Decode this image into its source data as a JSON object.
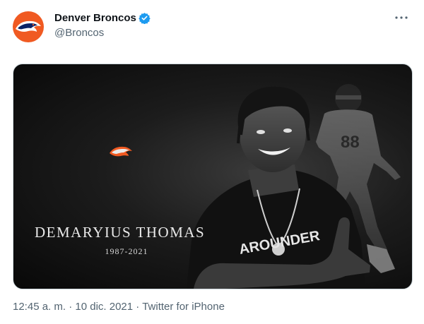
{
  "account": {
    "display_name": "Denver Broncos",
    "handle": "@Broncos",
    "avatar_icon": "broncos-logo-icon",
    "verified_icon": "verified-badge-icon",
    "brand_color": "#f05a22"
  },
  "menu": {
    "more_icon": "more-options-icon"
  },
  "media": {
    "name": "DEMARYIUS THOMAS",
    "years": "1987-2021",
    "jersey_number": "88",
    "shirt_text": "AROUNDER"
  },
  "meta": {
    "time": "12:45 a. m.",
    "separator": " · ",
    "date": "10 dic. 2021",
    "source": "Twitter for iPhone"
  }
}
